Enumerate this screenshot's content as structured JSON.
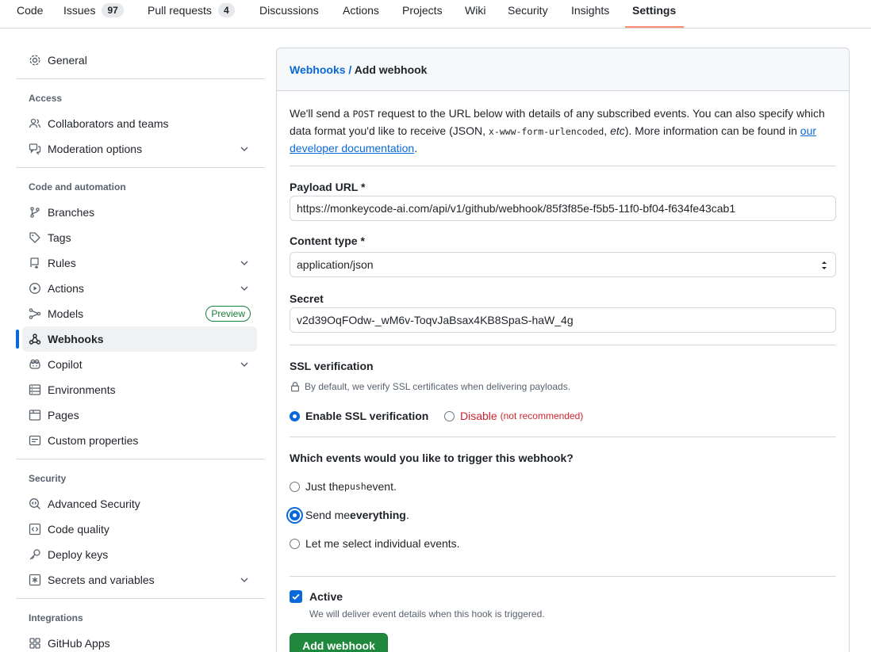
{
  "topnav": {
    "tabs": [
      {
        "label": "Code"
      },
      {
        "label": "Issues",
        "count": "97"
      },
      {
        "label": "Pull requests",
        "count": "4"
      },
      {
        "label": "Discussions"
      },
      {
        "label": "Actions"
      },
      {
        "label": "Projects"
      },
      {
        "label": "Wiki"
      },
      {
        "label": "Security"
      },
      {
        "label": "Insights"
      },
      {
        "label": "Settings",
        "active": true
      }
    ]
  },
  "sidebar": {
    "general": "General",
    "sections": {
      "access": "Access",
      "code_automation": "Code and automation",
      "security": "Security",
      "integrations": "Integrations"
    },
    "items": {
      "collaborators": "Collaborators and teams",
      "moderation": "Moderation options",
      "branches": "Branches",
      "tags": "Tags",
      "rules": "Rules",
      "actions": "Actions",
      "models": "Models",
      "models_badge": "Preview",
      "webhooks": "Webhooks",
      "copilot": "Copilot",
      "environments": "Environments",
      "pages": "Pages",
      "custom_properties": "Custom properties",
      "advanced_security": "Advanced Security",
      "code_quality": "Code quality",
      "deploy_keys": "Deploy keys",
      "secrets": "Secrets and variables",
      "github_apps": "GitHub Apps"
    }
  },
  "main": {
    "breadcrumb_link": "Webhooks",
    "breadcrumb_sep": " / ",
    "breadcrumb_current": "Add webhook",
    "intro": {
      "part1": "We'll send a ",
      "code1": "POST",
      "part2": " request to the URL below with details of any subscribed events. You can also specify which data format you'd like to receive (JSON, ",
      "code2": "x-www-form-urlencoded",
      "part3": ", ",
      "etc": "etc",
      "part4": "). More information can be found in ",
      "link": "our developer documentation",
      "part5": "."
    },
    "payload_url_label": "Payload URL *",
    "payload_url_value": "https://monkeycode-ai.com/api/v1/github/webhook/85f3f85e-f5b5-11f0-bf04-f634fe43cab1",
    "content_type_label": "Content type *",
    "content_type_value": "application/json",
    "secret_label": "Secret",
    "secret_value": "v2d39OqFOdw-_wM6v-ToqvJaBsax4KB8SpaS-haW_4g",
    "ssl_label": "SSL verification",
    "ssl_note": "By default, we verify SSL certificates when delivering payloads.",
    "ssl_enable": "Enable SSL verification",
    "ssl_disable": "Disable",
    "ssl_disable_note": "(not recommended)",
    "events_label": "Which events would you like to trigger this webhook?",
    "event_push_a": "Just the ",
    "event_push_code": "push",
    "event_push_b": " event.",
    "event_all_a": "Send me ",
    "event_all_b": "everything",
    "event_all_c": ".",
    "event_select": "Let me select individual events.",
    "active_label": "Active",
    "active_note": "We will deliver event details when this hook is triggered.",
    "submit_label": "Add webhook"
  },
  "colors": {
    "accent": "#0969da",
    "primary_button": "#1f883d",
    "danger": "#d1242f",
    "tab_underline": "#fd8c73"
  }
}
